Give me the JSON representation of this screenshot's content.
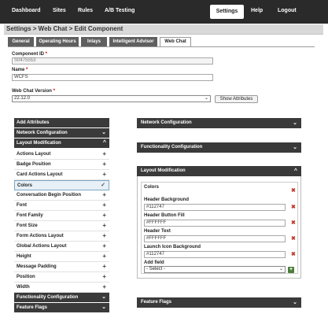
{
  "topnav": {
    "items": [
      "Dashboard",
      "Sites",
      "Rules",
      "A/B Testing"
    ],
    "active": "Settings",
    "right": [
      "Help",
      "Logout"
    ]
  },
  "titlebar": {
    "text": "Settings > Web Chat > Edit Component"
  },
  "tabs": [
    "General",
    "Operating Hours",
    "Inlays",
    "Intelligent Advisor",
    "Web Chat"
  ],
  "form": {
    "component_id_label": "Component ID",
    "component_id_value": "S0475553",
    "name_label": "Name",
    "name_value": "WCFS",
    "version_label": "Web Chat Version",
    "version_value": "22.12.0",
    "show_attributes": "Show Attributes",
    "required_mark": "*"
  },
  "left": {
    "add_attributes": "Add Attributes",
    "network_configuration": "Network Configuration",
    "layout_modification": "Layout Modification",
    "items": [
      "Actions Layout",
      "Badge Position",
      "Card Actions Layout",
      "Colors",
      "Conversation Begin Position",
      "Font",
      "Font Family",
      "Font Size",
      "Form Actions Layout",
      "Global Actions Layout",
      "Height",
      "Message Padding",
      "Position",
      "Width"
    ],
    "functionality_configuration": "Functionality Configuration",
    "feature_flags": "Feature Flags"
  },
  "right": {
    "network_configuration": "Network Configuration",
    "functionality_configuration": "Functionality Configuration",
    "layout_modification": "Layout Modification",
    "feature_flags": "Feature Flags",
    "colors": {
      "title": "Colors",
      "header_background_label": "Header Background",
      "header_background_value": "#112747",
      "header_button_fill_label": "Header Button Fill",
      "header_button_fill_value": "#FFFFFF",
      "header_text_label": "Header Text",
      "header_text_value": "#FFFFFF",
      "launch_icon_background_label": "Launch Icon Background",
      "launch_icon_background_value": "#112747",
      "add_field_label": "Add field",
      "add_field_value": "- Select -"
    }
  },
  "glyphs": {
    "plus": "+",
    "x": "✖",
    "check": "✓",
    "chev_down": "⌄",
    "chev_up": "^"
  }
}
